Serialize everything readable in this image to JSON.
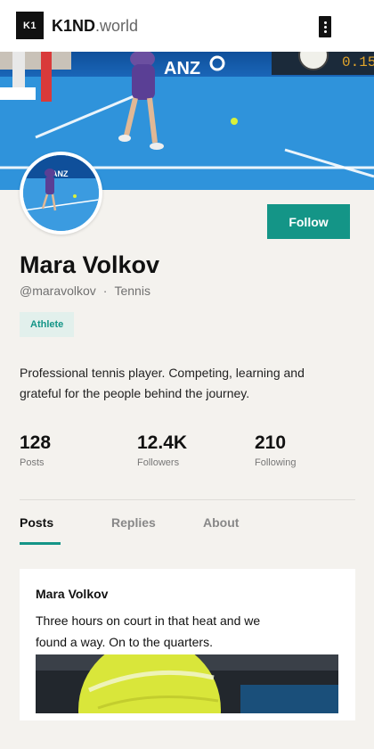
{
  "header": {
    "logo_mark": "K1",
    "brand": "K1ND",
    "tld": ".world",
    "menu_icon": "kebab-menu-icon"
  },
  "banner": {
    "sponsor": "ANZ",
    "clock_digits": "0.15"
  },
  "profile": {
    "name": "Mara Volkov",
    "handle": "@maravolkov",
    "sport": "Tennis",
    "badge": "Athlete",
    "bio": "Professional tennis player. Competing, learning and grateful for the people behind the journey.",
    "follow_label": "Follow"
  },
  "stats": [
    {
      "value": "128",
      "label": "Posts"
    },
    {
      "value": "12.4K",
      "label": "Followers"
    },
    {
      "value": "210",
      "label": "Following"
    }
  ],
  "tabs": [
    {
      "label": "Posts",
      "active": true
    },
    {
      "label": "Replies",
      "active": false
    },
    {
      "label": "About",
      "active": false
    }
  ],
  "post": {
    "author": "Mara Volkov",
    "text": "Three hours on court in that heat and we found a way. On to the quarters."
  },
  "colors": {
    "accent": "#149587",
    "court": "#2e8fd6",
    "background": "#f4f2ee"
  }
}
